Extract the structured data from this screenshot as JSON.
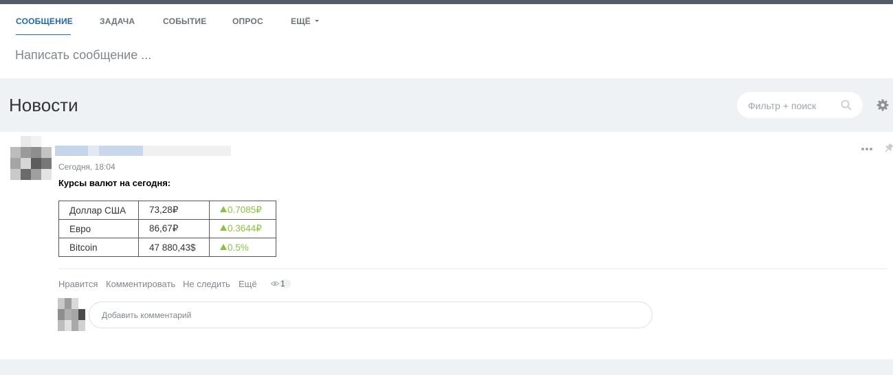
{
  "composer": {
    "tabs": [
      {
        "label": "СООБЩЕНИЕ"
      },
      {
        "label": "ЗАДАЧА"
      },
      {
        "label": "СОБЫТИЕ"
      },
      {
        "label": "ОПРОС"
      },
      {
        "label": "ЕЩЁ"
      }
    ],
    "placeholder": "Написать сообщение ..."
  },
  "feed": {
    "title": "Новости",
    "search_placeholder": "Фильтр + поиск"
  },
  "post": {
    "time": "Сегодня, 18:04",
    "headline": "Курсы валют на сегодня:",
    "table": [
      {
        "currency": "Доллар США",
        "rate": "73,28₽",
        "change": "0.7085₽"
      },
      {
        "currency": "Евро",
        "rate": "86,67₽",
        "change": "0.3644₽"
      },
      {
        "currency": "Bitcoin",
        "rate": "47 880,43$",
        "change": "0.5%"
      }
    ],
    "actions": {
      "like": "Нравится",
      "comment": "Комментировать",
      "unfollow": "Не следить",
      "more": "Ещё"
    },
    "views": "1",
    "comment_placeholder": "Добавить комментарий"
  },
  "colors": {
    "accent": "#2067b0",
    "positive": "#8ac43f",
    "background": "#eef2f4",
    "topbar": "#525c69"
  },
  "icons": {
    "search": "magnifier",
    "settings": "gear",
    "more": "three-dots",
    "pin": "pushpin",
    "views": "eye"
  }
}
